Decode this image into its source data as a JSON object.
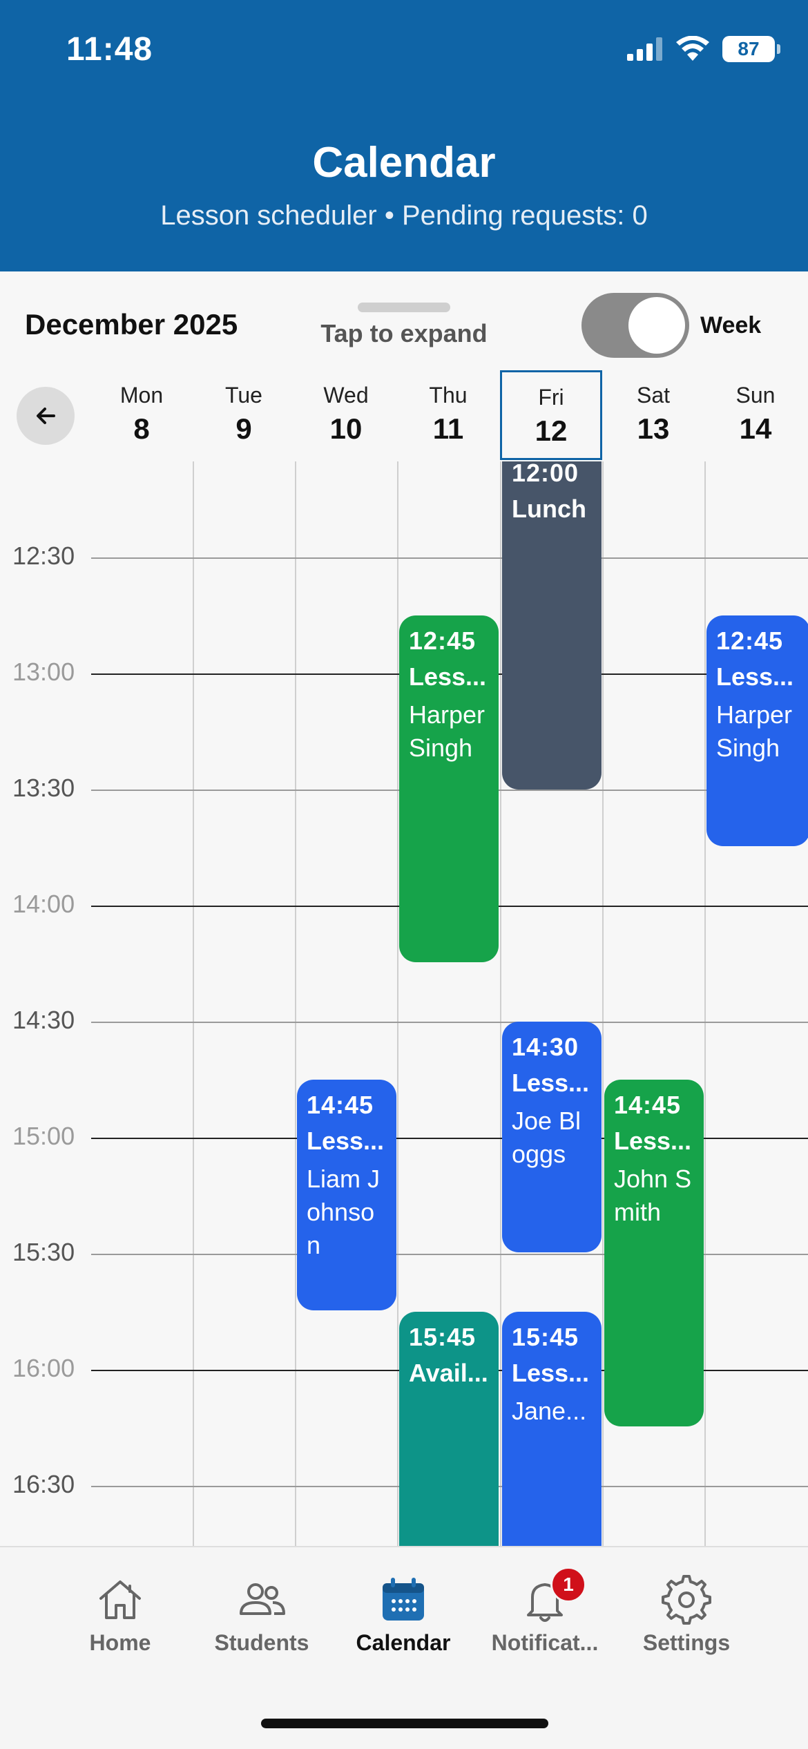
{
  "status_bar": {
    "time": "11:48",
    "battery": "87"
  },
  "header": {
    "title": "Calendar",
    "subtitle": "Lesson scheduler • Pending requests: 0"
  },
  "controls": {
    "month": "December 2025",
    "expand_hint": "Tap to expand",
    "view_label": "Week",
    "view_toggle_on": true
  },
  "days": [
    {
      "name": "Mon",
      "num": "8"
    },
    {
      "name": "Tue",
      "num": "9"
    },
    {
      "name": "Wed",
      "num": "10"
    },
    {
      "name": "Thu",
      "num": "11"
    },
    {
      "name": "Fri",
      "num": "12",
      "selected": true
    },
    {
      "name": "Sat",
      "num": "13"
    },
    {
      "name": "Sun",
      "num": "14"
    }
  ],
  "time_labels": [
    "12:30",
    "13:00",
    "13:30",
    "14:00",
    "14:30",
    "15:00",
    "15:30",
    "16:00",
    "16:30"
  ],
  "events": [
    {
      "time": "12:00",
      "title": "Lunch",
      "person": ""
    },
    {
      "time": "12:45",
      "title": "Less...",
      "person": "Harper Singh"
    },
    {
      "time": "12:45",
      "title": "Less...",
      "person": "Harper Singh"
    },
    {
      "time": "14:30",
      "title": "Less...",
      "person": "Joe Bloggs"
    },
    {
      "time": "14:45",
      "title": "Less...",
      "person": "Liam Johnson"
    },
    {
      "time": "14:45",
      "title": "Less...",
      "person": "John Smith"
    },
    {
      "time": "15:45",
      "title": "Avail...",
      "person": ""
    },
    {
      "time": "15:45",
      "title": "Less...",
      "person": "Jane..."
    }
  ],
  "colors": {
    "header": "#0f64a6",
    "lesson": "#2563eb",
    "green": "#16a34a",
    "lunch": "#475569",
    "available": "#0d9488",
    "badge": "#d0101a"
  },
  "nav": [
    {
      "label": "Home",
      "icon": "home-icon"
    },
    {
      "label": "Students",
      "icon": "students-icon"
    },
    {
      "label": "Calendar",
      "icon": "calendar-icon",
      "active": true
    },
    {
      "label": "Notificat...",
      "icon": "bell-icon",
      "badge": "1"
    },
    {
      "label": "Settings",
      "icon": "gear-icon"
    }
  ]
}
